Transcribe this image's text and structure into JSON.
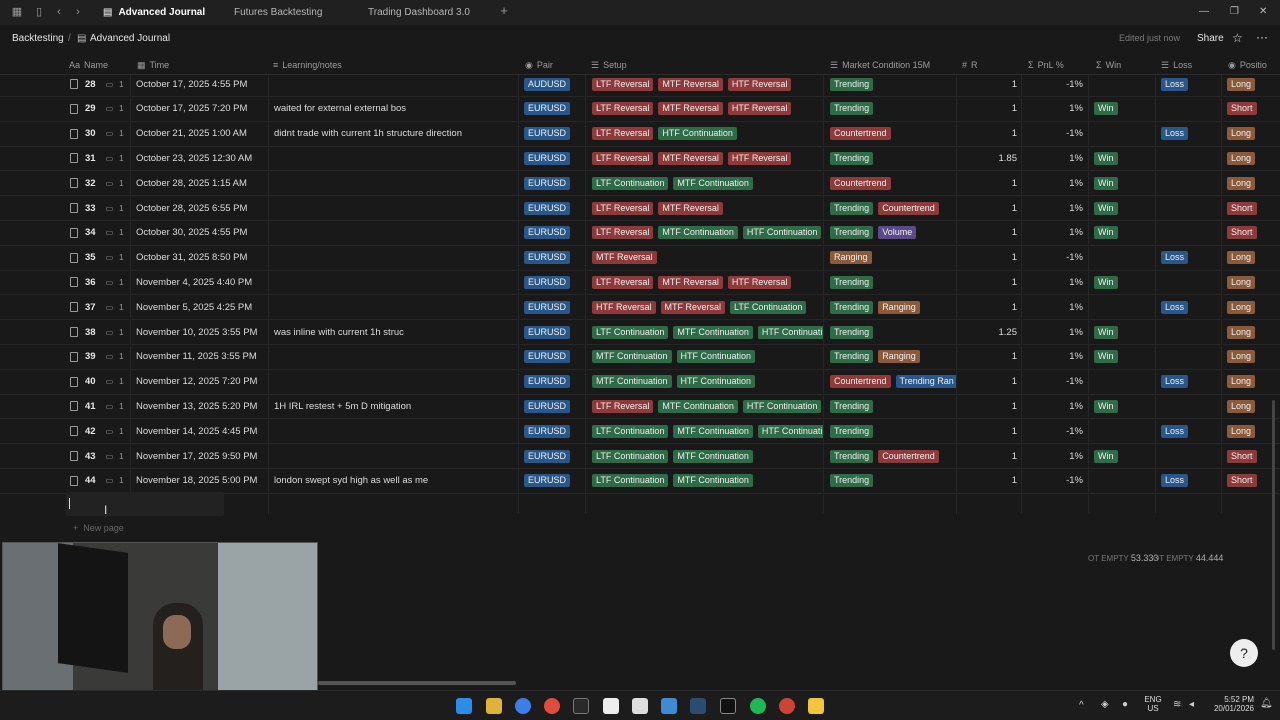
{
  "tabs": [
    {
      "label": "Advanced Journal",
      "active": true
    },
    {
      "label": "Futures Backtesting",
      "active": false
    },
    {
      "label": "Trading Dashboard 3.0",
      "active": false
    }
  ],
  "breadcrumb": [
    "Backtesting",
    "Advanced Journal"
  ],
  "topbar": {
    "edited": "Edited just now",
    "share": "Share"
  },
  "columns": [
    "Name",
    "Time",
    "Learning/notes",
    "Pair",
    "Setup",
    "Market Condition 15M",
    "R",
    "PnL %",
    "Win",
    "Loss",
    "Positio"
  ],
  "rows": [
    {
      "n": "28",
      "c": "1",
      "time": "October 17, 2025 4:55 PM",
      "note": "",
      "pair": "AUDUSD",
      "setup": [
        [
          "LTF Reversal",
          "red"
        ],
        [
          "MTF Reversal",
          "red"
        ],
        [
          "HTF Reversal",
          "red"
        ]
      ],
      "mc": [
        [
          "Trending",
          "green"
        ]
      ],
      "r": "1",
      "pnl": "-1%",
      "win": "",
      "loss": "Loss",
      "pos": "Long"
    },
    {
      "n": "29",
      "c": "1",
      "time": "October 17, 2025 7:20 PM",
      "note": "waited for external external bos",
      "pair": "EURUSD",
      "setup": [
        [
          "LTF Reversal",
          "red"
        ],
        [
          "MTF Reversal",
          "red"
        ],
        [
          "HTF Reversal",
          "red"
        ]
      ],
      "mc": [
        [
          "Trending",
          "green"
        ]
      ],
      "r": "1",
      "pnl": "1%",
      "win": "Win",
      "loss": "",
      "pos": "Short"
    },
    {
      "n": "30",
      "c": "1",
      "time": "October 21, 2025 1:00 AM",
      "note": "didnt trade with current 1h structure direction",
      "pair": "EURUSD",
      "setup": [
        [
          "LTF Reversal",
          "red"
        ],
        [
          "HTF Continuation",
          "green"
        ]
      ],
      "mc": [
        [
          "Countertrend",
          "red"
        ]
      ],
      "r": "1",
      "pnl": "-1%",
      "win": "",
      "loss": "Loss",
      "pos": "Long"
    },
    {
      "n": "31",
      "c": "1",
      "time": "October 23, 2025 12:30 AM",
      "note": "",
      "pair": "EURUSD",
      "setup": [
        [
          "LTF Reversal",
          "red"
        ],
        [
          "MTF Reversal",
          "red"
        ],
        [
          "HTF Reversal",
          "red"
        ]
      ],
      "mc": [
        [
          "Trending",
          "green"
        ]
      ],
      "r": "1.85",
      "pnl": "1%",
      "win": "Win",
      "loss": "",
      "pos": "Long"
    },
    {
      "n": "32",
      "c": "1",
      "time": "October 28, 2025 1:15 AM",
      "note": "",
      "pair": "EURUSD",
      "setup": [
        [
          "LTF Continuation",
          "green"
        ],
        [
          "MTF Continuation",
          "green"
        ]
      ],
      "mc": [
        [
          "Countertrend",
          "red"
        ]
      ],
      "r": "1",
      "pnl": "1%",
      "win": "Win",
      "loss": "",
      "pos": "Long"
    },
    {
      "n": "33",
      "c": "1",
      "time": "October 28, 2025 6:55 PM",
      "note": "",
      "pair": "EURUSD",
      "setup": [
        [
          "LTF Reversal",
          "red"
        ],
        [
          "MTF Reversal",
          "red"
        ]
      ],
      "mc": [
        [
          "Trending",
          "green"
        ],
        [
          "Countertrend",
          "red"
        ]
      ],
      "r": "1",
      "pnl": "1%",
      "win": "Win",
      "loss": "",
      "pos": "Short"
    },
    {
      "n": "34",
      "c": "1",
      "time": "October 30, 2025 4:55 PM",
      "note": "",
      "pair": "EURUSD",
      "setup": [
        [
          "LTF Reversal",
          "red"
        ],
        [
          "MTF Continuation",
          "green"
        ],
        [
          "HTF Continuation",
          "green"
        ]
      ],
      "mc": [
        [
          "Trending",
          "green"
        ],
        [
          "Volume",
          "purple"
        ]
      ],
      "r": "1",
      "pnl": "1%",
      "win": "Win",
      "loss": "",
      "pos": "Short"
    },
    {
      "n": "35",
      "c": "1",
      "time": "October 31, 2025 8:50 PM",
      "note": "",
      "pair": "EURUSD",
      "setup": [
        [
          "MTF Reversal",
          "red"
        ]
      ],
      "mc": [
        [
          "Ranging",
          "brown"
        ]
      ],
      "r": "1",
      "pnl": "-1%",
      "win": "",
      "loss": "Loss",
      "pos": "Long"
    },
    {
      "n": "36",
      "c": "1",
      "time": "November 4, 2025 4:40 PM",
      "note": "",
      "pair": "EURUSD",
      "setup": [
        [
          "LTF Reversal",
          "red"
        ],
        [
          "MTF Reversal",
          "red"
        ],
        [
          "HTF Reversal",
          "red"
        ]
      ],
      "mc": [
        [
          "Trending",
          "green"
        ]
      ],
      "r": "1",
      "pnl": "1%",
      "win": "Win",
      "loss": "",
      "pos": "Long"
    },
    {
      "n": "37",
      "c": "1",
      "time": "November 5, 2025 4:25 PM",
      "note": "",
      "pair": "EURUSD",
      "setup": [
        [
          "HTF Reversal",
          "red"
        ],
        [
          "MTF Reversal",
          "red"
        ],
        [
          "LTF Continuation",
          "green"
        ]
      ],
      "mc": [
        [
          "Trending",
          "green"
        ],
        [
          "Ranging",
          "brown"
        ]
      ],
      "r": "1",
      "pnl": "1%",
      "win": "",
      "loss": "Loss",
      "pos": "Long"
    },
    {
      "n": "38",
      "c": "1",
      "time": "November 10, 2025 3:55 PM",
      "note": "was inline with current 1h struc",
      "pair": "EURUSD",
      "setup": [
        [
          "LTF Continuation",
          "green"
        ],
        [
          "MTF Continuation",
          "green"
        ],
        [
          "HTF Continuati",
          "green"
        ]
      ],
      "mc": [
        [
          "Trending",
          "green"
        ]
      ],
      "r": "1.25",
      "pnl": "1%",
      "win": "Win",
      "loss": "",
      "pos": "Long"
    },
    {
      "n": "39",
      "c": "1",
      "time": "November 11, 2025 3:55 PM",
      "note": "",
      "pair": "EURUSD",
      "setup": [
        [
          "MTF Continuation",
          "green"
        ],
        [
          "HTF Continuation",
          "green"
        ]
      ],
      "mc": [
        [
          "Trending",
          "green"
        ],
        [
          "Ranging",
          "brown"
        ]
      ],
      "r": "1",
      "pnl": "1%",
      "win": "Win",
      "loss": "",
      "pos": "Long"
    },
    {
      "n": "40",
      "c": "1",
      "time": "November 12, 2025 7:20 PM",
      "note": "",
      "pair": "EURUSD",
      "setup": [
        [
          "MTF Continuation",
          "green"
        ],
        [
          "HTF Continuation",
          "green"
        ]
      ],
      "mc": [
        [
          "Countertrend",
          "red"
        ],
        [
          "Trending Ran",
          "blue"
        ]
      ],
      "r": "1",
      "pnl": "-1%",
      "win": "",
      "loss": "Loss",
      "pos": "Long"
    },
    {
      "n": "41",
      "c": "1",
      "time": "November 13, 2025 5:20 PM",
      "note": "1H IRL restest + 5m D mitigation",
      "pair": "EURUSD",
      "setup": [
        [
          "LTF Reversal",
          "red"
        ],
        [
          "MTF Continuation",
          "green"
        ],
        [
          "HTF Continuation",
          "green"
        ]
      ],
      "mc": [
        [
          "Trending",
          "green"
        ]
      ],
      "r": "1",
      "pnl": "1%",
      "win": "Win",
      "loss": "",
      "pos": "Long"
    },
    {
      "n": "42",
      "c": "1",
      "time": "November 14, 2025 4:45 PM",
      "note": "",
      "pair": "EURUSD",
      "setup": [
        [
          "LTF Continuation",
          "green"
        ],
        [
          "MTF Continuation",
          "green"
        ],
        [
          "HTF Continuati",
          "green"
        ]
      ],
      "mc": [
        [
          "Trending",
          "green"
        ]
      ],
      "r": "1",
      "pnl": "-1%",
      "win": "",
      "loss": "Loss",
      "pos": "Long"
    },
    {
      "n": "43",
      "c": "1",
      "time": "November 17, 2025 9:50 PM",
      "note": "",
      "pair": "EURUSD",
      "setup": [
        [
          "LTF Continuation",
          "green"
        ],
        [
          "MTF Continuation",
          "green"
        ]
      ],
      "mc": [
        [
          "Trending",
          "green"
        ],
        [
          "Countertrend",
          "red"
        ]
      ],
      "r": "1",
      "pnl": "1%",
      "win": "Win",
      "loss": "",
      "pos": "Short"
    },
    {
      "n": "44",
      "c": "1",
      "time": "November 18, 2025 5:00 PM",
      "note": "london swept syd high as well as me",
      "pair": "EURUSD",
      "setup": [
        [
          "LTF Continuation",
          "green"
        ],
        [
          "MTF Continuation",
          "green"
        ]
      ],
      "mc": [
        [
          "Trending",
          "green"
        ]
      ],
      "r": "1",
      "pnl": "-1%",
      "win": "",
      "loss": "Loss",
      "pos": "Short"
    }
  ],
  "new_page": "New page",
  "calc": {
    "win_label": "OT EMPTY",
    "win_value": "53.333",
    "loss_label": "OT EMPTY",
    "loss_value": "44.444"
  },
  "taskbar": {
    "lang": "ENG",
    "region": "US",
    "time": "5:52 PM",
    "date": "20/01/2026"
  },
  "colors": {
    "red": "#8e3a3a",
    "green": "#2e6b47",
    "blue": "#28578c",
    "brown": "#8a5a3a",
    "purple": "#5b4a8a"
  }
}
